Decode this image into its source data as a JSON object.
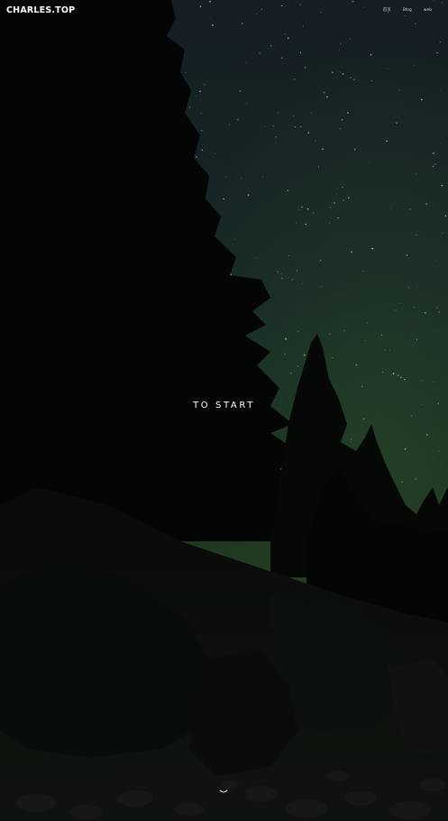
{
  "header": {
    "brand": "CHARLES.TOP",
    "nav": [
      {
        "label": "首页"
      },
      {
        "label": "Blog"
      },
      {
        "label": "web"
      }
    ]
  },
  "hero": {
    "cta_label": "TO START",
    "scroll_icon": "chevron-down-icon"
  },
  "colors": {
    "sky_top": "#1f2b34",
    "sky_mid": "#213d33",
    "sky_bottom": "#2c4a2e",
    "foreground": "#060907",
    "text": "#ffffff",
    "nav_text": "#c9ced4"
  }
}
